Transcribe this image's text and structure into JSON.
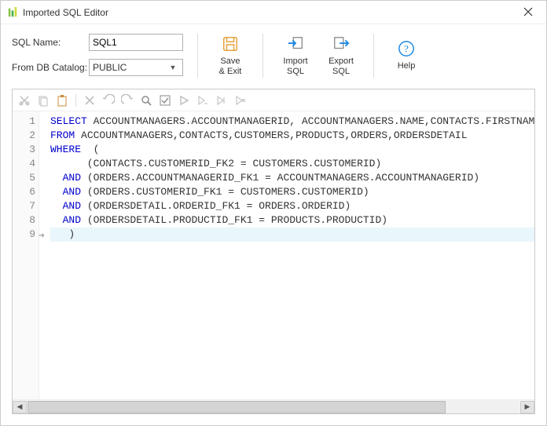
{
  "window": {
    "title": "Imported SQL Editor"
  },
  "form": {
    "sql_name_label": "SQL Name:",
    "sql_name_value": "SQL1",
    "db_catalog_label": "From DB Catalog:",
    "db_catalog_value": "PUBLIC"
  },
  "toolbar": {
    "save_exit": "Save\n& Exit",
    "import_sql": "Import\nSQL",
    "export_sql": "Export\nSQL",
    "help": "Help"
  },
  "editor_icons": [
    "cut-icon",
    "copy-icon",
    "paste-icon",
    "delete-icon",
    "undo-icon",
    "redo-icon",
    "find-icon",
    "toggle-icon",
    "run-icon",
    "run-to-icon",
    "step-icon",
    "stop-icon"
  ],
  "code": {
    "lines": [
      {
        "n": 1,
        "tokens": [
          [
            "SELECT",
            "kw"
          ],
          [
            " ACCOUNTMANAGERS.ACCOUNTMANAGERID, ACCOUNTMANAGERS.NAME,CONTACTS.FIRSTNAM",
            ""
          ]
        ]
      },
      {
        "n": 2,
        "tokens": [
          [
            "FROM",
            "kw"
          ],
          [
            " ACCOUNTMANAGERS,CONTACTS,CUSTOMERS,PRODUCTS,ORDERS,ORDERSDETAIL",
            ""
          ]
        ]
      },
      {
        "n": 3,
        "tokens": [
          [
            "WHERE",
            "kw"
          ],
          [
            "  (",
            ""
          ]
        ]
      },
      {
        "n": 4,
        "tokens": [
          [
            "      (CONTACTS.CUSTOMERID_FK2 = CUSTOMERS.CUSTOMERID)",
            ""
          ]
        ]
      },
      {
        "n": 5,
        "tokens": [
          [
            "  ",
            ""
          ],
          [
            "AND",
            "kw"
          ],
          [
            " (ORDERS.ACCOUNTMANAGERID_FK1 = ACCOUNTMANAGERS.ACCOUNTMANAGERID)",
            ""
          ]
        ]
      },
      {
        "n": 6,
        "tokens": [
          [
            "  ",
            ""
          ],
          [
            "AND",
            "kw"
          ],
          [
            " (ORDERS.CUSTOMERID_FK1 = CUSTOMERS.CUSTOMERID)",
            ""
          ]
        ]
      },
      {
        "n": 7,
        "tokens": [
          [
            "  ",
            ""
          ],
          [
            "AND",
            "kw"
          ],
          [
            " (ORDERSDETAIL.ORDERID_FK1 = ORDERS.ORDERID)",
            ""
          ]
        ]
      },
      {
        "n": 8,
        "tokens": [
          [
            "  ",
            ""
          ],
          [
            "AND",
            "kw"
          ],
          [
            " (ORDERSDETAIL.PRODUCTID_FK1 = PRODUCTS.PRODUCTID)",
            ""
          ]
        ]
      },
      {
        "n": 9,
        "current": true,
        "tokens": [
          [
            "   )",
            ""
          ]
        ]
      }
    ]
  }
}
